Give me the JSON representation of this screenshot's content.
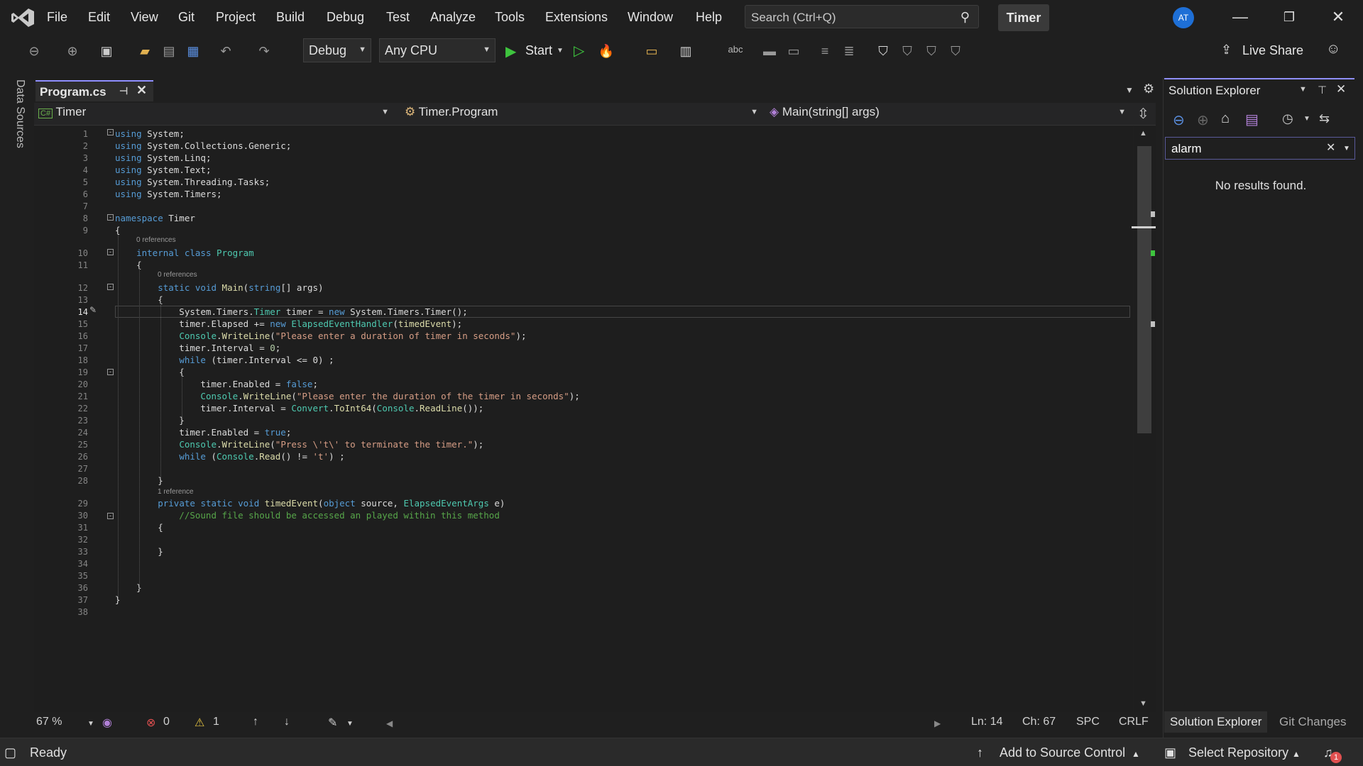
{
  "menu": [
    "File",
    "Edit",
    "View",
    "Git",
    "Project",
    "Build",
    "Debug",
    "Test",
    "Analyze",
    "Tools",
    "Extensions",
    "Window",
    "Help"
  ],
  "search": {
    "placeholder": "Search (Ctrl+Q)"
  },
  "solution_name": "Timer",
  "avatar_initials": "AT",
  "toolbar": {
    "config": "Debug",
    "platform": "Any CPU",
    "start_label": "Start",
    "live_share": "Live Share"
  },
  "left_strip": {
    "data_sources": "Data Sources"
  },
  "document_tab": {
    "name": "Program.cs"
  },
  "navbar": {
    "project": "Timer",
    "class": "Timer.Program",
    "member": "Main(string[] args)"
  },
  "code": {
    "line_numbers": [
      "1",
      "2",
      "3",
      "4",
      "5",
      "6",
      "7",
      "8",
      "9",
      "10",
      "11",
      "12",
      "13",
      "14",
      "15",
      "16",
      "17",
      "18",
      "19",
      "20",
      "21",
      "22",
      "23",
      "24",
      "25",
      "26",
      "27",
      "28",
      "29",
      "30",
      "31",
      "32",
      "33",
      "34",
      "35",
      "36",
      "37",
      "38"
    ],
    "lines": [
      "using System;",
      "using System.Collections.Generic;",
      "using System.Linq;",
      "using System.Text;",
      "using System.Threading.Tasks;",
      "using System.Timers;",
      "",
      "namespace Timer",
      "{",
      "    internal class Program",
      "    {",
      "        static void Main(string[] args)",
      "        {",
      "            System.Timers.Timer timer = new System.Timers.Timer();",
      "            timer.Elapsed += new ElapsedEventHandler(timedEvent);",
      "            Console.WriteLine(\"Please enter a duration of timer in seconds\");",
      "            timer.Interval = 0;",
      "            while (timer.Interval <= 0) ;",
      "            {",
      "                timer.Enabled = false;",
      "                Console.WriteLine(\"Please enter the duration of the timer in seconds\");",
      "                timer.Interval = Convert.ToInt64(Console.ReadLine());",
      "            }",
      "            timer.Enabled = true;",
      "            Console.WriteLine(\"Press \\'t\\' to terminate the timer.\");",
      "            while (Console.Read() != 't') ;",
      "",
      "        }",
      "        private static void timedEvent(object source, ElapsedEventArgs e)",
      "            //Sound file should be accessed an played within this method",
      "        {",
      "",
      "        }",
      "",
      "",
      "    }",
      "}",
      ""
    ],
    "ref_labels": {
      "class": "0 references",
      "main": "0 references",
      "timed": "1 reference"
    }
  },
  "editor_status": {
    "zoom": "67 %",
    "errors": "0",
    "warnings": "1",
    "line": "Ln: 14",
    "col": "Ch: 67",
    "spacing": "SPC",
    "eol": "CRLF"
  },
  "solution_explorer": {
    "title": "Solution Explorer",
    "search_value": "alarm",
    "message": "No results found.",
    "tabs": [
      "Solution Explorer",
      "Git Changes"
    ]
  },
  "statusbar": {
    "ready": "Ready",
    "add_source": "Add to Source Control",
    "select_repo": "Select Repository",
    "notifications": "1"
  }
}
